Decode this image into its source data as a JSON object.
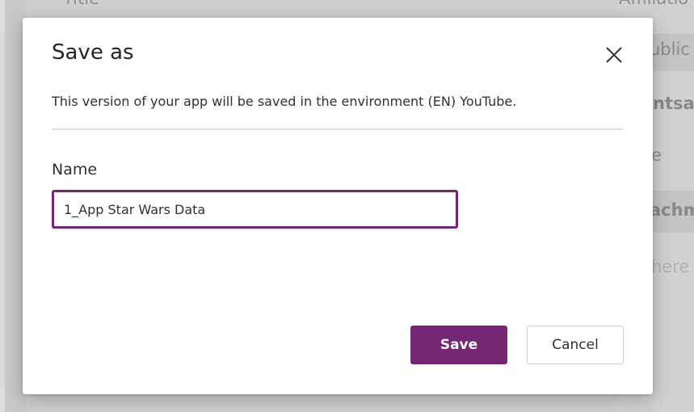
{
  "background": {
    "column_title": "Title",
    "column_affiliation": "Affiliatio",
    "row_text_1": "ublic",
    "row_text_2": "ntsab",
    "row_text_3": "e",
    "row_text_4": "achm",
    "row_text_5": "here i"
  },
  "dialog": {
    "title": "Save as",
    "description": "This version of your app will be saved in the environment (EN) YouTube.",
    "name_label": "Name",
    "name_value": "1_App Star Wars Data",
    "save_label": "Save",
    "cancel_label": "Cancel",
    "close_icon": "close-icon"
  },
  "colors": {
    "accent": "#742774",
    "divider": "#e1dfdd"
  }
}
